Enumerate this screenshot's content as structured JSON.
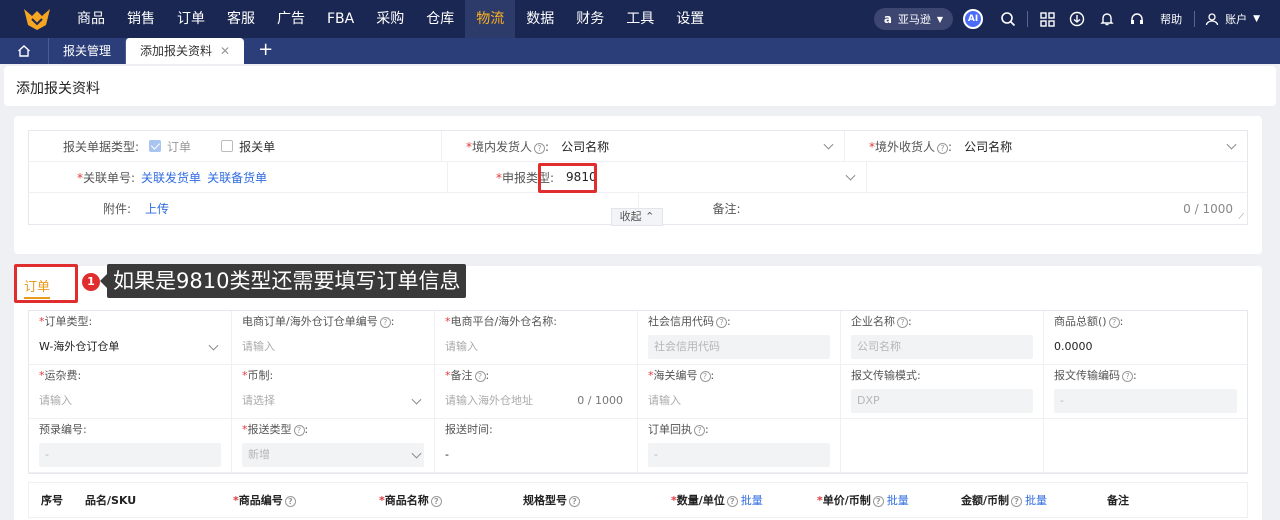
{
  "nav": {
    "items": [
      "商品",
      "销售",
      "订单",
      "客服",
      "广告",
      "FBA",
      "采购",
      "仓库",
      "物流",
      "数据",
      "财务",
      "工具",
      "设置"
    ],
    "active_index": 8,
    "marketplace": "亚马逊",
    "ai": "AI",
    "help": "帮助",
    "account": "账户"
  },
  "tabs": {
    "items": [
      "报关管理",
      "添加报关资料"
    ],
    "active_index": 1,
    "add": "+"
  },
  "page": {
    "title": "添加报关资料"
  },
  "form": {
    "doc_type_label": "报关单据类型:",
    "opt_order": "订单",
    "opt_declaration": "报关单",
    "shipper_label": "境内发货人",
    "shipper_value": "公司名称",
    "consignee_label": "境外收货人",
    "consignee_value": "公司名称",
    "related_label": "关联单号:",
    "related_link1": "关联发货单",
    "related_link2": "关联备货单",
    "declare_type_label": "申报类型:",
    "declare_type_value": "9810",
    "attach_label": "附件:",
    "attach_link": "上传",
    "remark_label": "备注:",
    "remark_counter": "0 / 1000",
    "collapse": "收起"
  },
  "annotation": {
    "badge": "1",
    "text": "如果是9810类型还需要填写订单信息"
  },
  "order": {
    "tab": "订单",
    "fields": [
      {
        "label": "订单类型:",
        "req": true,
        "q": false,
        "value": "W-海外仓订仓单",
        "kind": "select-filled"
      },
      {
        "label": "电商订单/海外仓订仓单编号",
        "req": false,
        "q": true,
        "value": "请输入",
        "kind": "input"
      },
      {
        "label": "电商平台/海外仓名称:",
        "req": true,
        "q": false,
        "value": "请输入",
        "kind": "input"
      },
      {
        "label": "社会信用代码",
        "req": false,
        "q": true,
        "value": "社会信用代码",
        "kind": "disabled"
      },
      {
        "label": "企业名称",
        "req": false,
        "q": true,
        "value": "公司名称",
        "kind": "disabled"
      },
      {
        "label": "商品总额()",
        "req": false,
        "q": true,
        "value": "0.0000",
        "kind": "strong"
      },
      {
        "label": "运杂费:",
        "req": true,
        "q": false,
        "value": "请输入",
        "kind": "input"
      },
      {
        "label": "币制:",
        "req": true,
        "q": false,
        "value": "请选择",
        "kind": "select"
      },
      {
        "label": "备注",
        "req": true,
        "q": true,
        "value": "请输入海外仓地址",
        "kind": "textarea",
        "counter": "0 / 1000"
      },
      {
        "label": "海关编号",
        "req": true,
        "q": true,
        "value": "请输入",
        "kind": "input"
      },
      {
        "label": "报文传输模式:",
        "req": false,
        "q": false,
        "value": "DXP",
        "kind": "disabled"
      },
      {
        "label": "报文传输编码",
        "req": false,
        "q": true,
        "value": "-",
        "kind": "disabled"
      },
      {
        "label": "预录编号:",
        "req": false,
        "q": false,
        "value": "-",
        "kind": "disabled"
      },
      {
        "label": "报送类型",
        "req": true,
        "q": true,
        "value": "新增",
        "kind": "disabled-select"
      },
      {
        "label": "报送时间:",
        "req": false,
        "q": false,
        "value": "-",
        "kind": "strong"
      },
      {
        "label": "订单回执",
        "req": false,
        "q": true,
        "value": "-",
        "kind": "disabled"
      },
      {
        "label": "",
        "req": false,
        "q": false,
        "value": "",
        "kind": "empty"
      },
      {
        "label": "",
        "req": false,
        "q": false,
        "value": "",
        "kind": "empty"
      }
    ],
    "columns": [
      {
        "label": "序号",
        "req": false,
        "q": false,
        "batch": ""
      },
      {
        "label": "品名/SKU",
        "req": false,
        "q": false,
        "batch": ""
      },
      {
        "label": "商品编号",
        "req": true,
        "q": true,
        "batch": ""
      },
      {
        "label": "商品名称",
        "req": true,
        "q": true,
        "batch": ""
      },
      {
        "label": "规格型号",
        "req": false,
        "q": true,
        "batch": ""
      },
      {
        "label": "数量/单位",
        "req": true,
        "q": true,
        "batch": "批量"
      },
      {
        "label": "单价/币制",
        "req": true,
        "q": true,
        "batch": "批量"
      },
      {
        "label": "金额/币制",
        "req": false,
        "q": true,
        "batch": "批量"
      },
      {
        "label": "备注",
        "req": false,
        "q": false,
        "batch": ""
      }
    ]
  }
}
